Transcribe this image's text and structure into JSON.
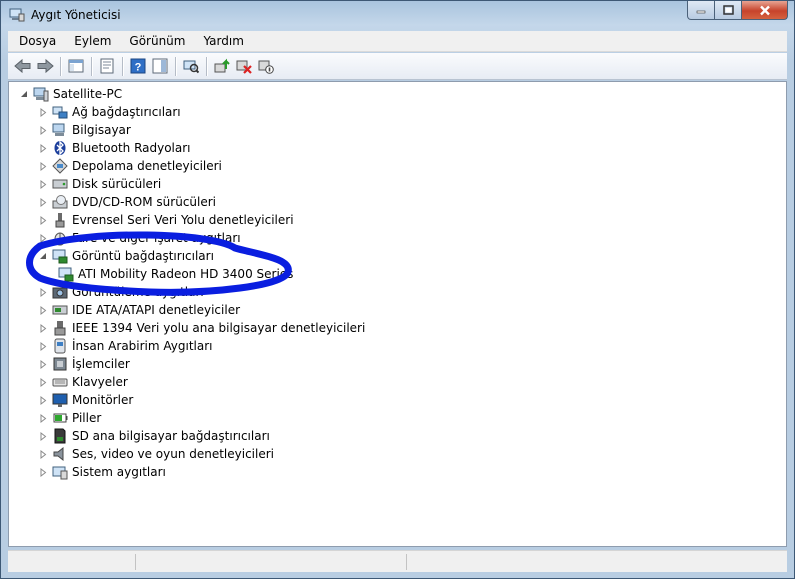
{
  "window": {
    "title": "Aygıt Yöneticisi"
  },
  "menu": [
    "Dosya",
    "Eylem",
    "Görünüm",
    "Yardım"
  ],
  "tree": {
    "root": "Satellite-PC",
    "categories": [
      "Ağ bağdaştırıcıları",
      "Bilgisayar",
      "Bluetooth Radyoları",
      "Depolama denetleyicileri",
      "Disk sürücüleri",
      "DVD/CD-ROM sürücüleri",
      "Evrensel Seri Veri Yolu denetleyicileri",
      "Fare ve diğer işaret aygıtları",
      "Görüntü bağdaştırıcıları",
      "Görüntüleme aygıtları",
      "IDE ATA/ATAPI denetleyiciler",
      "IEEE 1394 Veri yolu ana bilgisayar denetleyicileri",
      "İnsan Arabirim Aygıtları",
      "İşlemciler",
      "Klavyeler",
      "Monitörler",
      "Piller",
      "SD ana bilgisayar bağdaştırıcıları",
      "Ses, video ve oyun denetleyicileri",
      "Sistem aygıtları"
    ],
    "expanded_child": "ATI Mobility Radeon HD 3400 Series"
  },
  "colors": {
    "annotation": "#0a1ee0",
    "selection": "#3399ff"
  }
}
